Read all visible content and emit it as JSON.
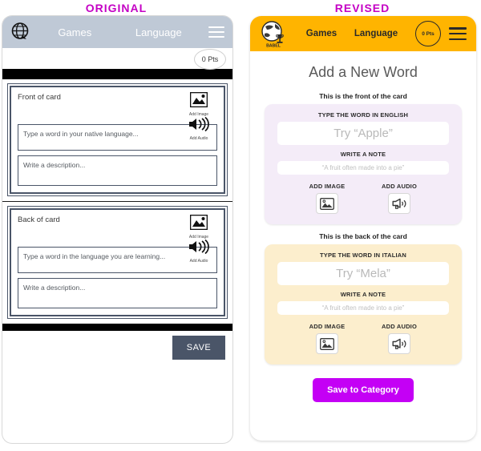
{
  "captions": {
    "left": "ORIGINAL",
    "right": "REVISED",
    "color": "#c400c4"
  },
  "original": {
    "nav": {
      "logo_icon": "globe-icon",
      "links": [
        "Games",
        "Language"
      ],
      "menu_icon": "hamburger-icon"
    },
    "points_badge": "0 Pts",
    "front_card": {
      "title": "Front of card",
      "add_image_label": "Add Image",
      "add_audio_label": "Add Audio",
      "word_placeholder": "Type a word in your native language...",
      "description_placeholder": "Write a description..."
    },
    "back_card": {
      "title": "Back of card",
      "add_image_label": "Add Image",
      "add_audio_label": "Add Audio",
      "word_placeholder": "Type a word in the language you are learning...",
      "description_placeholder": "Write a description..."
    },
    "save_label": "SAVE",
    "colors": {
      "navbar": "#bfc9d6",
      "card_border": "#4a5568",
      "save_button": "#4a5568"
    }
  },
  "revised": {
    "nav": {
      "logo_icon": "babel-globe-trophy-logo",
      "logo_text": "BABEL",
      "links": [
        "Games",
        "Language"
      ],
      "points_badge": "0 Pts",
      "menu_icon": "hamburger-icon"
    },
    "page_title": "Add a New Word",
    "front": {
      "section_label": "This is the front of the card",
      "word_label": "TYPE THE WORD IN ENGLISH",
      "word_placeholder": "Try “Apple”",
      "note_label": "WRITE A NOTE",
      "note_placeholder": "“A fruit often made into a pie”",
      "add_image_label": "ADD IMAGE",
      "add_audio_label": "ADD AUDIO"
    },
    "back": {
      "section_label": "This is the back of the card",
      "word_label": "TYPE THE WORD IN ITALIAN",
      "word_placeholder": "Try “Mela”",
      "note_label": "WRITE A NOTE",
      "note_placeholder": "“A fruit often made into a pie”",
      "add_image_label": "ADD IMAGE",
      "add_audio_label": "ADD AUDIO"
    },
    "save_label": "Save to Category",
    "colors": {
      "navbar": "#ffb400",
      "front_card": "#f4ecf8",
      "back_card": "#fceecd",
      "save_button": "#c400f5"
    }
  }
}
